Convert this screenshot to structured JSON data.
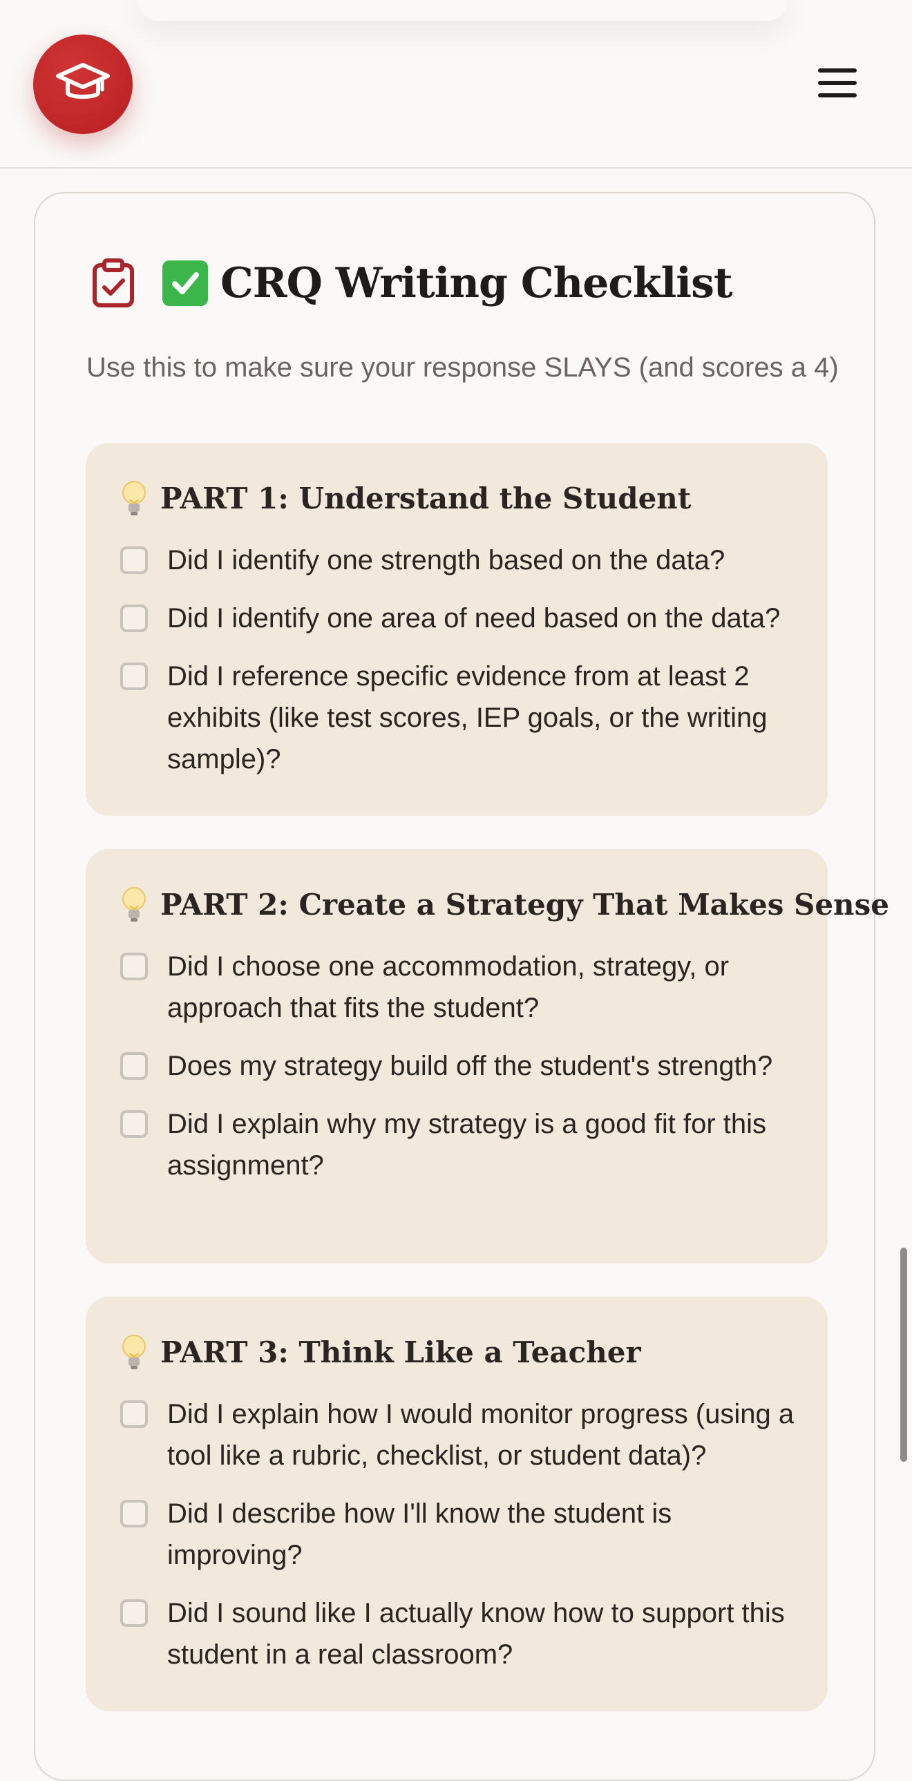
{
  "header": {
    "logo_icon": "graduation-cap-icon",
    "menu_icon": "hamburger-menu-icon",
    "accent_color": "#c4252a"
  },
  "card": {
    "title_icon": "clipboard-check-icon",
    "title_emoji": "✅",
    "title": "CRQ Writing Checklist",
    "subtitle": "Use this to make sure your response SLAYS (and scores a 4)"
  },
  "sections": [
    {
      "icon": "lightbulb-icon",
      "title": "PART 1: Understand the Student",
      "items": [
        "Did I identify one strength based on the data?",
        "Did I identify one area of need based on the data?",
        "Did I reference specific evidence from at least 2 exhibits (like test scores, IEP goals, or the writing sample)?"
      ]
    },
    {
      "icon": "lightbulb-icon",
      "title": "PART 2: Create a Strategy That Makes Sense",
      "items": [
        "Did I choose one accommodation, strategy, or approach that fits the student?",
        "Does my strategy build off the student's strength?",
        "Did I explain why my strategy is a good fit for this assignment?"
      ]
    },
    {
      "icon": "lightbulb-icon",
      "title": "PART 3: Think Like a Teacher",
      "items": [
        "Did I explain how I would monitor progress (using a tool like a rubric, checklist, or student data)?",
        "Did I describe how I'll know the student is improving?",
        "Did I sound like I actually know how to support this student in a real classroom?"
      ]
    }
  ]
}
